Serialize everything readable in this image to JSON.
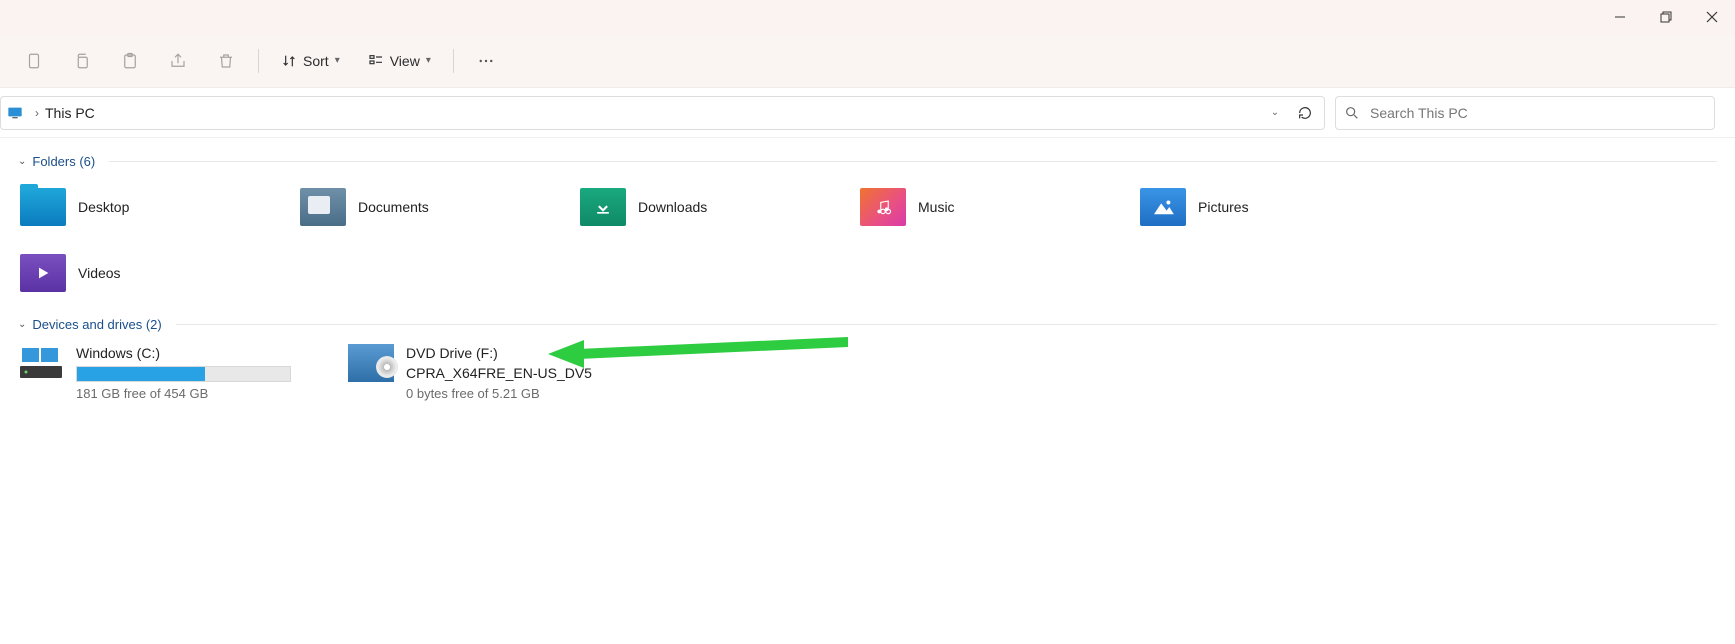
{
  "window": {
    "minimize": "Minimize",
    "maximize": "Restore",
    "close": "Close"
  },
  "toolbar": {
    "sort": "Sort",
    "view": "View"
  },
  "address": {
    "location": "This PC"
  },
  "search": {
    "placeholder": "Search This PC"
  },
  "groups": {
    "folders_header": "Folders (6)",
    "drives_header": "Devices and drives (2)"
  },
  "folders": {
    "desktop": "Desktop",
    "documents": "Documents",
    "downloads": "Downloads",
    "music": "Music",
    "pictures": "Pictures",
    "videos": "Videos"
  },
  "drives": {
    "c": {
      "name": "Windows (C:)",
      "free": "181 GB free of 454 GB",
      "used_percent": 60
    },
    "f": {
      "line1": "DVD Drive (F:)",
      "line2": "CPRA_X64FRE_EN-US_DV5",
      "free": "0 bytes free of 5.21 GB"
    }
  }
}
